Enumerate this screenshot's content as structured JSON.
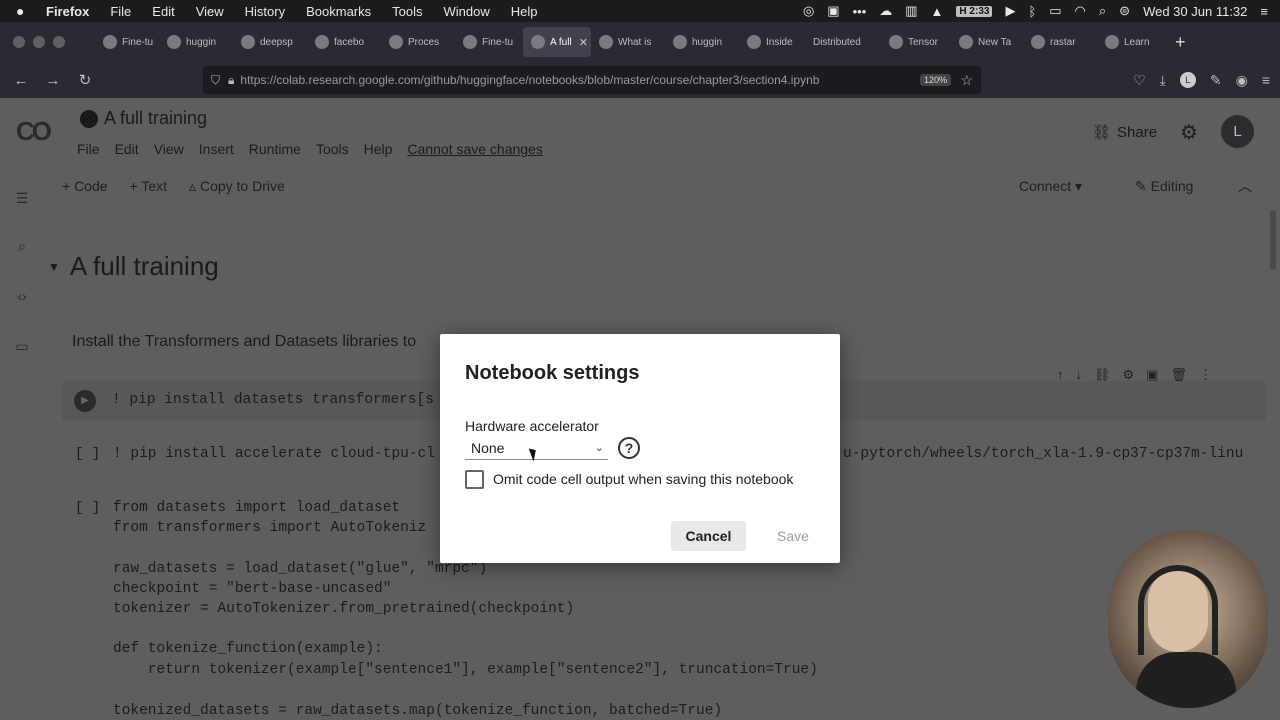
{
  "os_menubar": {
    "apple": "",
    "app": "Firefox",
    "items": [
      "File",
      "Edit",
      "View",
      "History",
      "Bookmarks",
      "Tools",
      "Window",
      "Help"
    ],
    "badge_text": "H 2:33",
    "clock": "Wed 30 Jun  11:32"
  },
  "tabs": [
    {
      "label": "Fine-tu",
      "icon": "hf-icon"
    },
    {
      "label": "huggin",
      "icon": "github-icon"
    },
    {
      "label": "deepsp",
      "icon": "deepspeed-icon"
    },
    {
      "label": "facebo",
      "icon": "hf-icon"
    },
    {
      "label": "Proces",
      "icon": "colab-icon"
    },
    {
      "label": "Fine-tu",
      "icon": "colab-icon"
    },
    {
      "label": "A full",
      "icon": "colab-icon",
      "active": true
    },
    {
      "label": "What is",
      "icon": "drop-icon"
    },
    {
      "label": "huggin",
      "icon": "github-icon"
    },
    {
      "label": "Inside",
      "icon": "dots-icon"
    },
    {
      "label": "Distributed",
      "icon": "none"
    },
    {
      "label": "Tensor",
      "icon": "w-icon"
    },
    {
      "label": "New Ta",
      "icon": "firefox-icon"
    },
    {
      "label": "rastar",
      "icon": "github-icon"
    },
    {
      "label": "Learn",
      "icon": "doc-icon"
    }
  ],
  "urlbar": {
    "url": "https://colab.research.google.com/github/huggingface/notebooks/blob/master/course/chapter3/section4.ipynb",
    "zoom": "120%"
  },
  "colab": {
    "logo": "CO",
    "title": "A full training",
    "menu": [
      "File",
      "Edit",
      "View",
      "Insert",
      "Runtime",
      "Tools",
      "Help"
    ],
    "save_notice": "Cannot save changes",
    "share": "Share",
    "avatar_initial": "L",
    "toolbar": {
      "code": "+ Code",
      "text": "+ Text",
      "copy": "Copy to Drive"
    },
    "connect": "Connect",
    "editing": "Editing",
    "section_title": "A full training",
    "intro_text": "Install the Transformers and Datasets libraries to",
    "cell1_code": "! pip install datasets transformers[s",
    "cell2_code": "! pip install accelerate cloud-tpu-cl",
    "cell2_code_right": "u-pytorch/wheels/torch_xla-1.9-cp37-cp37m-linu",
    "cell3_lines": [
      "from datasets import load_dataset",
      "from transformers import AutoTokeniz",
      "",
      "raw_datasets = load_dataset(\"glue\", \"mrpc\")",
      "checkpoint = \"bert-base-uncased\"",
      "tokenizer = AutoTokenizer.from_pretrained(checkpoint)",
      "",
      "def tokenize_function(example):",
      "    return tokenizer(example[\"sentence1\"], example[\"sentence2\"], truncation=True)",
      "",
      "tokenized_datasets = raw_datasets.map(tokenize_function, batched=True)"
    ],
    "bracket": "[ ]"
  },
  "dialog": {
    "title": "Notebook settings",
    "hw_label": "Hardware accelerator",
    "hw_value": "None",
    "help": "?",
    "omit_label": "Omit code cell output when saving this notebook",
    "omit_checked": false,
    "cancel": "Cancel",
    "save": "Save"
  }
}
